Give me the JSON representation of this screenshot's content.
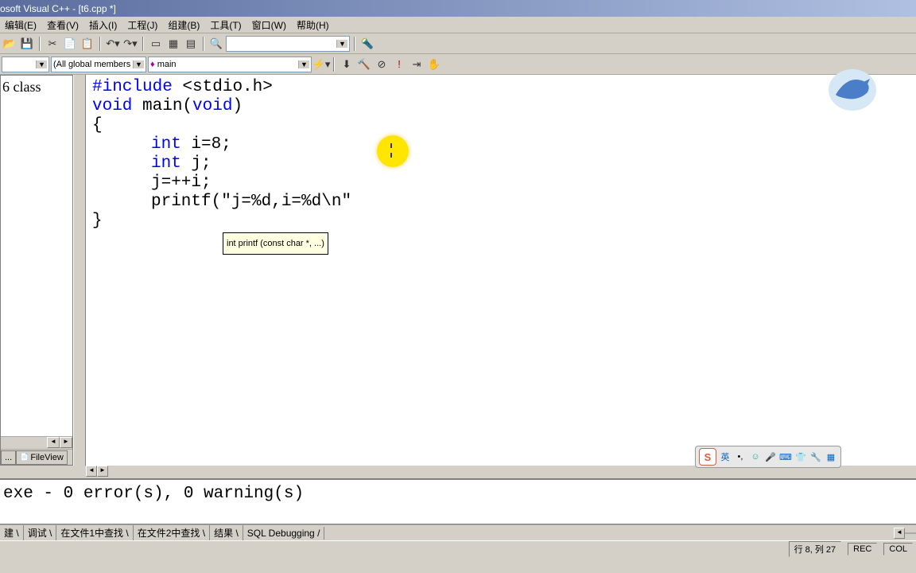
{
  "title": "osoft Visual C++ - [t6.cpp *]",
  "menu": {
    "file": "编辑(E)",
    "view": "查看(V)",
    "insert": "插入(I)",
    "project": "工程(J)",
    "build": "组建(B)",
    "tools": "工具(T)",
    "window": "窗口(W)",
    "help": "帮助(H)"
  },
  "toolbar2": {
    "combo_scope": "(All global members",
    "combo_func": "main",
    "func_icon": "♦"
  },
  "sidepanel": {
    "text": "class",
    "prefix": "6",
    "tab1": "...",
    "tab2": "FileView"
  },
  "code": {
    "l1_kw": "#include",
    "l1_rest": " <stdio.h>",
    "l2_kw1": "void",
    "l2_mid": " main(",
    "l2_kw2": "void",
    "l2_end": ")",
    "l3": "{",
    "l4": "",
    "l5_kw": "int",
    "l5_rest": " i=8;",
    "l6_kw": "int",
    "l6_rest": " j;",
    "l7": "j=++i;",
    "l8_a": "printf(",
    "l8_str": "\"j=%d,i=%d\\n\"",
    "l9": "}",
    "tooltip": "int printf (const char *, ...)"
  },
  "output": {
    "line": "exe - 0 error(s), 0 warning(s)"
  },
  "output_tabs": {
    "t1": "建",
    "t2": "调试",
    "t3": "在文件1中查找",
    "t4": "在文件2中查找",
    "t5": "结果",
    "t6": "SQL Debugging"
  },
  "status": {
    "pos": "行 8, 列 27",
    "rec": "REC",
    "col": "COL"
  },
  "ime": {
    "logo": "S",
    "lang": "英"
  }
}
